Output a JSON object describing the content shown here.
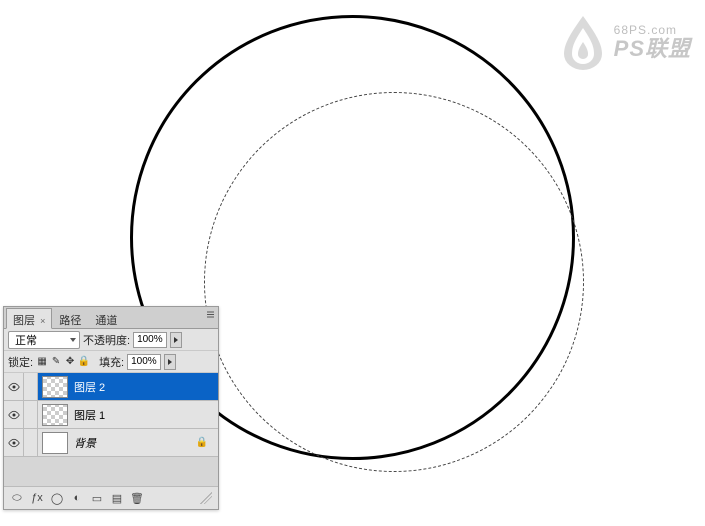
{
  "watermark": {
    "url": "68PS.com",
    "brand": "PS联盟"
  },
  "panel": {
    "tabs": [
      {
        "label": "图层",
        "active": true,
        "closable": true
      },
      {
        "label": "路径",
        "active": false
      },
      {
        "label": "通道",
        "active": false
      }
    ],
    "blend_mode": "正常",
    "opacity_label": "不透明度:",
    "opacity_value": "100%",
    "lock_label": "锁定:",
    "fill_label": "填充:",
    "fill_value": "100%",
    "layers": [
      {
        "name": "图层 2",
        "selected": true,
        "checker": true,
        "locked": false
      },
      {
        "name": "图层 1",
        "selected": false,
        "checker": true,
        "locked": false
      },
      {
        "name": "背景",
        "selected": false,
        "checker": false,
        "locked": true
      }
    ]
  }
}
